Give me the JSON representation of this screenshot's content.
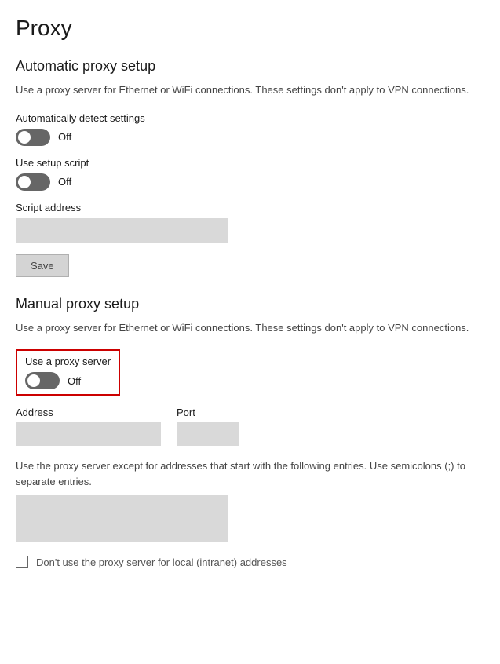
{
  "page": {
    "title": "Proxy"
  },
  "automatic_section": {
    "title": "Automatic proxy setup",
    "description": "Use a proxy server for Ethernet or WiFi connections. These settings don't apply to VPN connections.",
    "auto_detect": {
      "label": "Automatically detect settings",
      "state_label": "Off"
    },
    "setup_script": {
      "label": "Use setup script",
      "state_label": "Off"
    },
    "script_address": {
      "label": "Script address",
      "placeholder": ""
    },
    "save_button": "Save"
  },
  "manual_section": {
    "title": "Manual proxy setup",
    "description": "Use a proxy server for Ethernet or WiFi connections. These settings don't apply to VPN connections.",
    "use_proxy": {
      "label": "Use a proxy server",
      "state_label": "Off"
    },
    "address": {
      "label": "Address",
      "placeholder": ""
    },
    "port": {
      "label": "Port",
      "placeholder": ""
    },
    "exceptions_desc": "Use the proxy server except for addresses that start with the following entries. Use semicolons (;) to separate entries.",
    "exceptions_placeholder": "",
    "local_checkbox_label": "Don't use the proxy server for local (intranet) addresses"
  }
}
